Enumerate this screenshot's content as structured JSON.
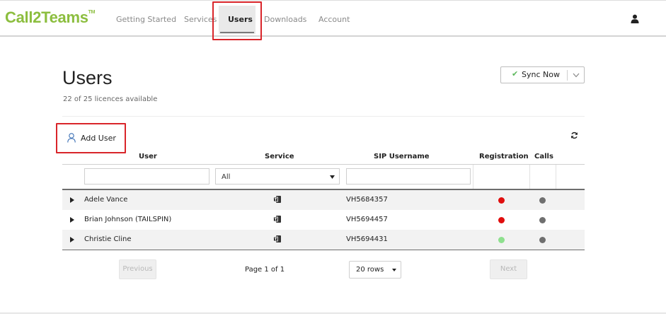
{
  "app": {
    "logo": "Call2Teams",
    "logo_mark": "TM"
  },
  "nav": {
    "items": [
      {
        "label": "Getting Started"
      },
      {
        "label": "Services"
      },
      {
        "label": "Users",
        "active": true
      },
      {
        "label": "Downloads"
      },
      {
        "label": "Account"
      }
    ],
    "account_icon": "user-icon"
  },
  "header": {
    "title": "Users",
    "licences": "22 of 25 licences available",
    "sync_label": "Sync Now",
    "sync_icon": "check-icon"
  },
  "toolbar": {
    "add_user_label": "Add User",
    "add_user_icon": "user-outline-icon",
    "refresh_icon": "refresh-icon"
  },
  "table": {
    "columns": [
      "User",
      "Service",
      "SIP Username",
      "Registration",
      "Calls"
    ],
    "filters": {
      "user_value": "",
      "service_value": "All",
      "sip_value": ""
    },
    "rows": [
      {
        "user": "Adele Vance",
        "service_icon": "teams-icon",
        "sip": "VH5684357",
        "registration": "red",
        "calls": "grey"
      },
      {
        "user": "Brian Johnson (TAILSPIN)",
        "service_icon": "teams-icon",
        "sip": "VH5694457",
        "registration": "red",
        "calls": "grey"
      },
      {
        "user": "Christie Cline",
        "service_icon": "teams-icon",
        "sip": "VH5694431",
        "registration": "green",
        "calls": "grey"
      }
    ]
  },
  "pagination": {
    "previous_label": "Previous",
    "page_info": "Page 1 of 1",
    "rows_per_page": "20 rows",
    "next_label": "Next"
  },
  "colors": {
    "brand": "#8cbe3f",
    "highlight": "#d9252a",
    "status_red": "#e00e0e",
    "status_green": "#8ee08e",
    "status_grey": "#6f6f6f"
  }
}
